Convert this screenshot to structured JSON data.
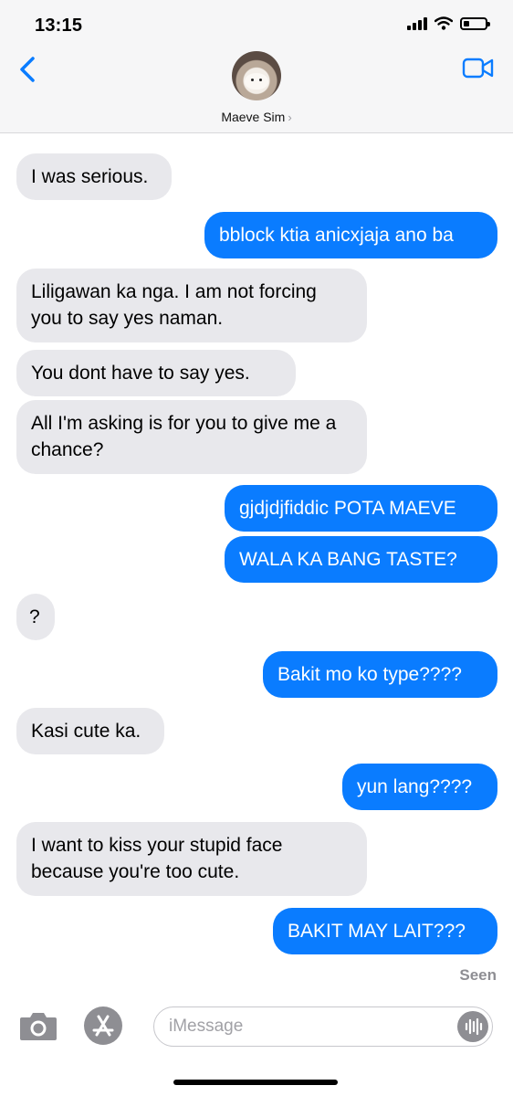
{
  "status_bar": {
    "time": "13:15",
    "battery_level": 0.25
  },
  "header": {
    "contact_name": "Maeve Sim",
    "chevron": "›"
  },
  "icons": {
    "back": "chevron-left-icon",
    "video": "video-camera-icon",
    "camera": "camera-icon",
    "apps": "app-store-icon",
    "audio": "audio-waveform-icon"
  },
  "colors": {
    "accent": "#0a7cff",
    "incoming_bubble": "#e8e8ec",
    "header_bg": "#f6f6f7"
  },
  "messages": [
    {
      "from": "contact",
      "text": "I was serious."
    },
    {
      "from": "me",
      "text": "bblock ktia anicxjaja ano ba"
    },
    {
      "from": "contact",
      "text": "Liligawan ka nga. I am not forcing you to say yes naman."
    },
    {
      "from": "contact",
      "text": "You dont have to say yes."
    },
    {
      "from": "contact",
      "text": "All I'm asking is for you to give me a chance?"
    },
    {
      "from": "me",
      "text": "gjdjdjfiddic POTA MAEVE"
    },
    {
      "from": "me",
      "text": "WALA KA BANG TASTE?"
    },
    {
      "from": "contact",
      "text": "?"
    },
    {
      "from": "me",
      "text": "Bakit mo ko type????"
    },
    {
      "from": "contact",
      "text": "Kasi cute ka."
    },
    {
      "from": "me",
      "text": "yun lang????"
    },
    {
      "from": "contact",
      "text": "I want to kiss your stupid face because you're too cute."
    },
    {
      "from": "me",
      "text": "BAKIT MAY LAIT???"
    }
  ],
  "read_receipt": "Seen",
  "composer": {
    "placeholder": "iMessage"
  }
}
